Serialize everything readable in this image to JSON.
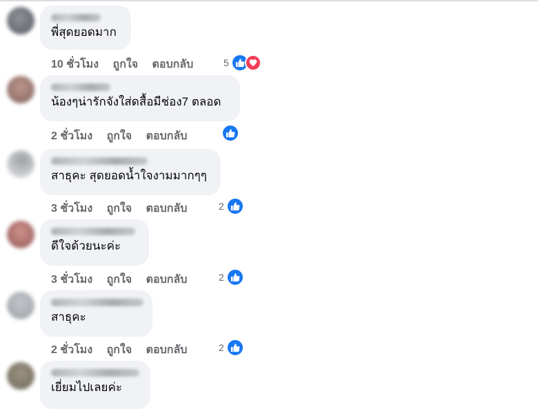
{
  "comments": [
    {
      "text": "พี่สุดยอดมาก",
      "time": "10 ชั่วโมง",
      "like": "ถูกใจ",
      "reply": "ตอบกลับ",
      "reaction_count": "5",
      "reactions": [
        "like-icon",
        "love-icon"
      ]
    },
    {
      "text": "น้องๆน่ารักจังใส่ดสื้อมีช่อง7 ตลอด",
      "time": "2 ชั่วโมง",
      "like": "ถูกใจ",
      "reply": "ตอบกลับ",
      "reaction_count": "",
      "reactions": [
        "like-icon"
      ]
    },
    {
      "text": "สาธุคะ สุดยอดน้ำใจงามมากๆๆ",
      "time": "3 ชั่วโมง",
      "like": "ถูกใจ",
      "reply": "ตอบกลับ",
      "reaction_count": "2",
      "reactions": [
        "like-icon"
      ]
    },
    {
      "text": "ดีใจด้วยนะค่ะ",
      "time": "3 ชั่วโมง",
      "like": "ถูกใจ",
      "reply": "ตอบกลับ",
      "reaction_count": "2",
      "reactions": [
        "like-icon"
      ]
    },
    {
      "text": "สาธุคะ",
      "time": "2 ชั่วโมง",
      "like": "ถูกใจ",
      "reply": "ตอบกลับ",
      "reaction_count": "2",
      "reactions": [
        "like-icon"
      ]
    },
    {
      "text": "เยี่ยมไปเลยค่ะ",
      "time": "",
      "like": "",
      "reply": "",
      "reaction_count": "",
      "reactions": []
    }
  ],
  "colors": {
    "like": "#1877f2",
    "love": "#f33e58",
    "bubble": "#f0f2f5",
    "meta": "#65676b"
  }
}
